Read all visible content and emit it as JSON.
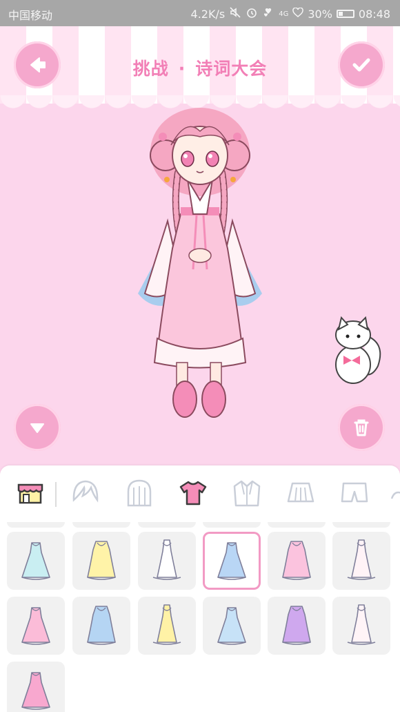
{
  "status_bar": {
    "carrier": "中国移动",
    "network_speed": "4.2K/s",
    "signal_label": "4G",
    "battery": "30%",
    "battery_level": 0.3,
    "time": "08:48"
  },
  "header": {
    "title_left": "挑战",
    "title_sep": "·",
    "title_right": "诗词大会"
  },
  "colors": {
    "accent_pink": "#f5a8cd",
    "title_pink": "#f27fb6",
    "background_pink": "#fcd6ec",
    "selected_border": "#f29ac4"
  },
  "categories": [
    {
      "icon": "shop-icon",
      "selected": false
    },
    {
      "icon": "hair-front-icon",
      "selected": false
    },
    {
      "icon": "hair-back-icon",
      "selected": false
    },
    {
      "icon": "top-shirt-icon",
      "selected": true
    },
    {
      "icon": "jacket-icon",
      "selected": false
    },
    {
      "icon": "skirt-icon",
      "selected": false
    },
    {
      "icon": "shorts-icon",
      "selected": false
    },
    {
      "icon": "accessory-icon",
      "selected": false
    }
  ],
  "dresses": [
    {
      "icon": "mint-dress-icon",
      "color": "#c9eef2",
      "selected": false
    },
    {
      "icon": "yellow-dress-icon",
      "color": "#fff3a8",
      "selected": false
    },
    {
      "icon": "white-slip-dress-icon",
      "color": "#ffffff",
      "selected": false
    },
    {
      "icon": "blue-hanfu-dress-icon",
      "color": "#b9d6f5",
      "selected": true
    },
    {
      "icon": "pink-pinafore-dress-icon",
      "color": "#fbc3de",
      "selected": false
    },
    {
      "icon": "white-ruffle-dress-icon",
      "color": "#fff3f7",
      "selected": false
    },
    {
      "icon": "pink-ballgown-icon",
      "color": "#fbbcd8",
      "selected": false
    },
    {
      "icon": "blue-bow-dress-icon",
      "color": "#b5d5f3",
      "selected": false
    },
    {
      "icon": "yellow-collar-dress-icon",
      "color": "#fff2a6",
      "selected": false
    },
    {
      "icon": "light-blue-dress-icon",
      "color": "#c7e2f7",
      "selected": false
    },
    {
      "icon": "purple-gradient-dress-icon",
      "color": "#cfa8ee",
      "selected": false
    },
    {
      "icon": "white-bow-dress-icon",
      "color": "#fff4f7",
      "selected": false
    },
    {
      "icon": "pink-tiered-dress-icon",
      "color": "#f8a8cf",
      "selected": false
    }
  ]
}
